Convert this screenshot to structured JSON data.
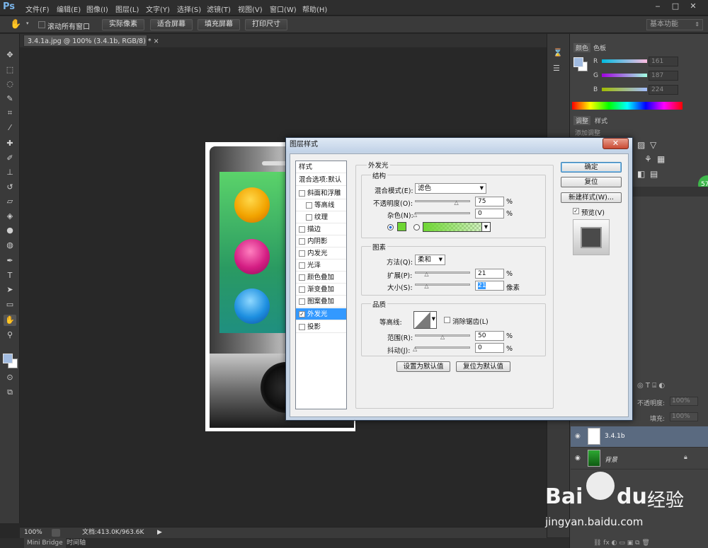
{
  "app": {
    "logo": "Ps"
  },
  "menu": [
    "文件(F)",
    "编辑(E)",
    "图像(I)",
    "图层(L)",
    "文字(Y)",
    "选择(S)",
    "滤镜(T)",
    "视图(V)",
    "窗口(W)",
    "帮助(H)"
  ],
  "options": {
    "scroll_all_label": "滚动所有窗口",
    "buttons": [
      "实际像素",
      "适合屏幕",
      "填充屏幕",
      "打印尺寸"
    ],
    "workspace": "基本功能"
  },
  "document": {
    "tab": "3.4.1a.jpg @ 100% (3.4.1b, RGB/8) *"
  },
  "status": {
    "zoom": "100%",
    "doc_size": "文档:413.0K/963.6K"
  },
  "bottom_tabs": [
    "Mini Bridge",
    "时间轴"
  ],
  "color_panel": {
    "tabs": [
      "颜色",
      "色板"
    ],
    "channels": [
      {
        "name": "R",
        "value": "161"
      },
      {
        "name": "G",
        "value": "187"
      },
      {
        "name": "B",
        "value": "224"
      }
    ],
    "fg_color": "#a1bbe0"
  },
  "adjust_panel": {
    "tabs": [
      "调整",
      "样式"
    ],
    "title": "添加调整"
  },
  "layers_panel": {
    "opacity_label": "不透明度:",
    "opacity_value": "100%",
    "fill_label": "填充:",
    "fill_value": "100%",
    "layers": [
      {
        "name": "3.4.1b"
      },
      {
        "name": "背景"
      }
    ]
  },
  "dialog": {
    "title": "图层样式",
    "close": "✕",
    "styles_header": "样式",
    "blend_default": "混合选项:默认",
    "style_items": [
      {
        "label": "斜面和浮雕",
        "checked": false
      },
      {
        "label": "等高线",
        "checked": false
      },
      {
        "label": "纹理",
        "checked": false
      },
      {
        "label": "描边",
        "checked": false
      },
      {
        "label": "内阴影",
        "checked": false
      },
      {
        "label": "内发光",
        "checked": false
      },
      {
        "label": "光泽",
        "checked": false
      },
      {
        "label": "颜色叠加",
        "checked": false
      },
      {
        "label": "渐变叠加",
        "checked": false
      },
      {
        "label": "图案叠加",
        "checked": false
      },
      {
        "label": "外发光",
        "checked": true
      },
      {
        "label": "投影",
        "checked": false
      }
    ],
    "section_title": "外发光",
    "structure": {
      "title": "结构",
      "blend_mode_label": "混合模式(E):",
      "blend_mode": "滤色",
      "opacity_label": "不透明度(O):",
      "opacity": "75",
      "opacity_pct": 75,
      "noise_label": "杂色(N):",
      "noise": "0",
      "noise_pct": 0,
      "percent": "%",
      "glow_color": "#6fd634"
    },
    "elements": {
      "title": "图素",
      "technique_label": "方法(Q):",
      "technique": "柔和",
      "spread_label": "扩展(P):",
      "spread": "21",
      "spread_pct": 21,
      "size_label": "大小(S):",
      "size": "21",
      "size_unit": "像素",
      "percent": "%"
    },
    "quality": {
      "title": "品质",
      "contour_label": "等高线:",
      "antialias_label": "消除锯齿(L)",
      "range_label": "范围(R):",
      "range": "50",
      "range_pct": 50,
      "jitter_label": "抖动(J):",
      "jitter": "0",
      "jitter_pct": 0,
      "percent": "%"
    },
    "make_default": "设置为默认值",
    "reset_default": "复位为默认值",
    "buttons": {
      "ok": "确定",
      "reset": "复位",
      "new_style": "新建样式(W)...",
      "preview": "预览(V)"
    }
  },
  "watermark": {
    "brand": "Bai",
    "paw": "du",
    "cn": "经验",
    "url": "jingyan.baidu.com"
  }
}
